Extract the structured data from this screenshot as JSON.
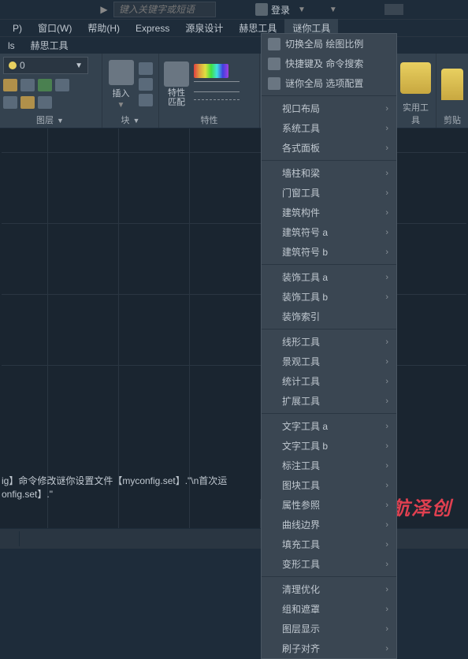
{
  "titlebar": {
    "search_placeholder": "键入关键字或短语",
    "login_label": "登录"
  },
  "menubar": {
    "items": [
      "P)",
      "窗口(W)",
      "帮助(H)",
      "Express",
      "源泉设计",
      "赫思工具",
      "谜你工具"
    ]
  },
  "tabbar": {
    "t1": "ls",
    "t2": "赫思工具"
  },
  "ribbon": {
    "layer": {
      "value": "0",
      "group_label": "图层"
    },
    "block": {
      "insert_label": "插入",
      "group_label": "块"
    },
    "props": {
      "match_label": "特性\n匹配",
      "group_label": "特性"
    },
    "util": {
      "label": "实用工具"
    },
    "clip": {
      "label": "剪贴"
    }
  },
  "cmd": {
    "line1_a": "ig】命令修改谜你设置文件【myconfig.set】.\"\\n首次运",
    "line2_a": "onfig.set】.\""
  },
  "menu": {
    "top": [
      {
        "label1": "切换全局",
        "label2": "绘图比例"
      },
      {
        "label1": "快捷键及",
        "label2": "命令搜索"
      },
      {
        "label1": "谜你全局",
        "label2": "选项配置"
      }
    ],
    "groups": [
      [
        {
          "label": "视口布局",
          "sub": true
        },
        {
          "label": "系统工具",
          "sub": true
        },
        {
          "label": "各式面板",
          "sub": true
        }
      ],
      [
        {
          "label": "墙柱和梁",
          "sub": true
        },
        {
          "label": "门窗工具",
          "sub": true
        },
        {
          "label": "建筑构件",
          "sub": true
        },
        {
          "label": "建筑符号 a",
          "sub": true
        },
        {
          "label": "建筑符号 b",
          "sub": true
        }
      ],
      [
        {
          "label": "装饰工具 a",
          "sub": true
        },
        {
          "label": "装饰工具 b",
          "sub": true
        },
        {
          "label": "装饰索引",
          "sub": false
        }
      ],
      [
        {
          "label": "线形工具",
          "sub": true
        },
        {
          "label": "景观工具",
          "sub": true
        },
        {
          "label": "统计工具",
          "sub": true
        },
        {
          "label": "扩展工具",
          "sub": true
        }
      ],
      [
        {
          "label": "文字工具 a",
          "sub": true
        },
        {
          "label": "文字工具 b",
          "sub": true
        },
        {
          "label": "标注工具",
          "sub": true
        },
        {
          "label": "图块工具",
          "sub": true
        },
        {
          "label": "属性参照",
          "sub": true
        },
        {
          "label": "曲线边界",
          "sub": true
        },
        {
          "label": "填充工具",
          "sub": true
        },
        {
          "label": "变形工具",
          "sub": true
        }
      ],
      [
        {
          "label": "清理优化",
          "sub": true
        },
        {
          "label": "组和遮罩",
          "sub": true
        },
        {
          "label": "图层显示",
          "sub": true
        },
        {
          "label": "刷子对齐",
          "sub": true
        }
      ]
    ]
  },
  "watermark": "领航泽创"
}
